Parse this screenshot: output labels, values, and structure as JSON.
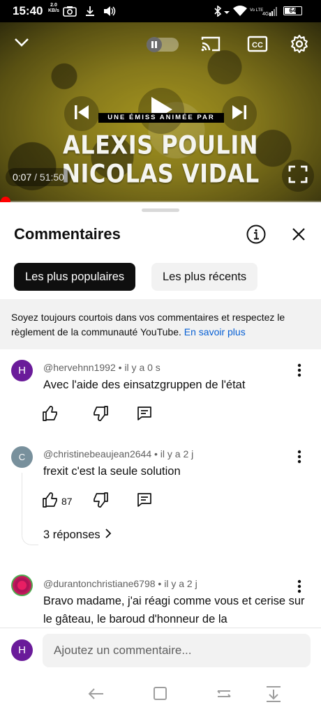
{
  "status": {
    "time": "15:40",
    "net_speed": "2.0",
    "net_unit": "KB/s",
    "battery": "64"
  },
  "video": {
    "banner": "UNE ÉMISS     ANIMÉE PAR",
    "name_line1": "ALEXIS POULIN",
    "name_line2": "NICOLAS VIDAL",
    "current_time": "0:07",
    "duration": "51:50",
    "progress_fraction": 0.0023,
    "icons": [
      "chevron-down-icon",
      "pause-icon",
      "cast-icon",
      "cc-icon",
      "gear-icon",
      "previous-icon",
      "play-icon",
      "next-icon",
      "fullscreen-icon"
    ],
    "accent_color": "#ff0000"
  },
  "comments_panel": {
    "title": "Commentaires",
    "chips": [
      "Les plus populaires",
      "Les plus récents"
    ],
    "notice_text": "Soyez toujours courtois dans vos commentaires et respectez le règlement de la communauté YouTube.",
    "notice_link": "En savoir plus",
    "comments": [
      {
        "avatar_letter": "H",
        "avatar_color": "#6a1b9a",
        "author": "@hervehnn1992",
        "time": "il y a 0 s",
        "text": "Avec l'aide des einsatzgruppen de l'état",
        "likes": ""
      },
      {
        "avatar_letter": "C",
        "avatar_color": "#78909c",
        "author": "@christinebeaujean2644",
        "time": "il y a 2 j",
        "text": "frexit c'est la seule solution",
        "likes": "87",
        "replies": "3 réponses"
      },
      {
        "avatar_letter": "",
        "avatar_color": "#c2185b",
        "author": "@durantonchristiane6798",
        "time": "il y a 2 j",
        "text": "Bravo madame, j'ai réagi comme vous et cerise sur le gâteau, le baroud d'honneur de la",
        "likes": ""
      }
    ],
    "input_avatar_letter": "H",
    "input_placeholder": "Ajoutez un commentaire..."
  },
  "nav": {
    "icons": [
      "back-icon",
      "home-icon",
      "recents-icon",
      "collapse-icon"
    ]
  }
}
